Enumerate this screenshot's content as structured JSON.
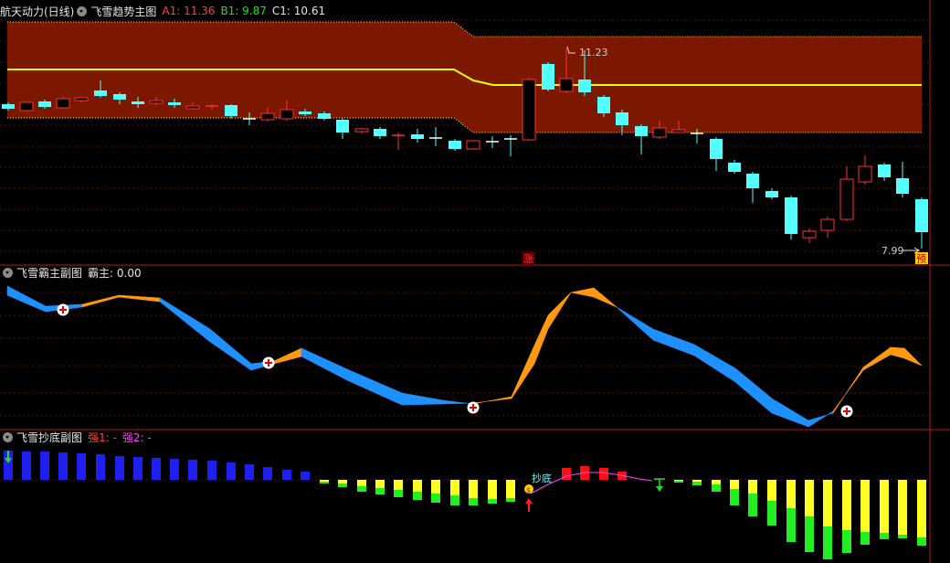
{
  "main_pane": {
    "stock_name": "航天动力(日线)",
    "indicator_name": "飞雪趋势主图",
    "readouts": [
      {
        "label": "A1: 11.36",
        "color": "#ff4040"
      },
      {
        "label": "B1: 9.87",
        "color": "#22dd22"
      },
      {
        "label": "C1: 10.61",
        "color": "#e6e6e6"
      }
    ],
    "high_label": "11.23",
    "low_label": "7.99",
    "zhang_badge": "涨",
    "yu_badge": "预"
  },
  "sub_pane1": {
    "indicator_name": "飞雪霸主副图",
    "readout": "霸主: 0.00"
  },
  "sub_pane2": {
    "indicator_name": "飞雪抄底副图",
    "readout1": "强1: -",
    "readout2": "强2: -",
    "buy_label": "抄底"
  },
  "colors": {
    "up": "#ff3030",
    "down": "#54ffff",
    "band": "#7c1800",
    "band_line": "#ffff00",
    "ribbon_blue": "#1e90ff",
    "ribbon_orange": "#ff9a10",
    "bar_blue": "#1f1ff0",
    "bar_yellow": "#ffff22",
    "bar_green": "#22ee22",
    "bar_red": "#ff1010"
  }
}
